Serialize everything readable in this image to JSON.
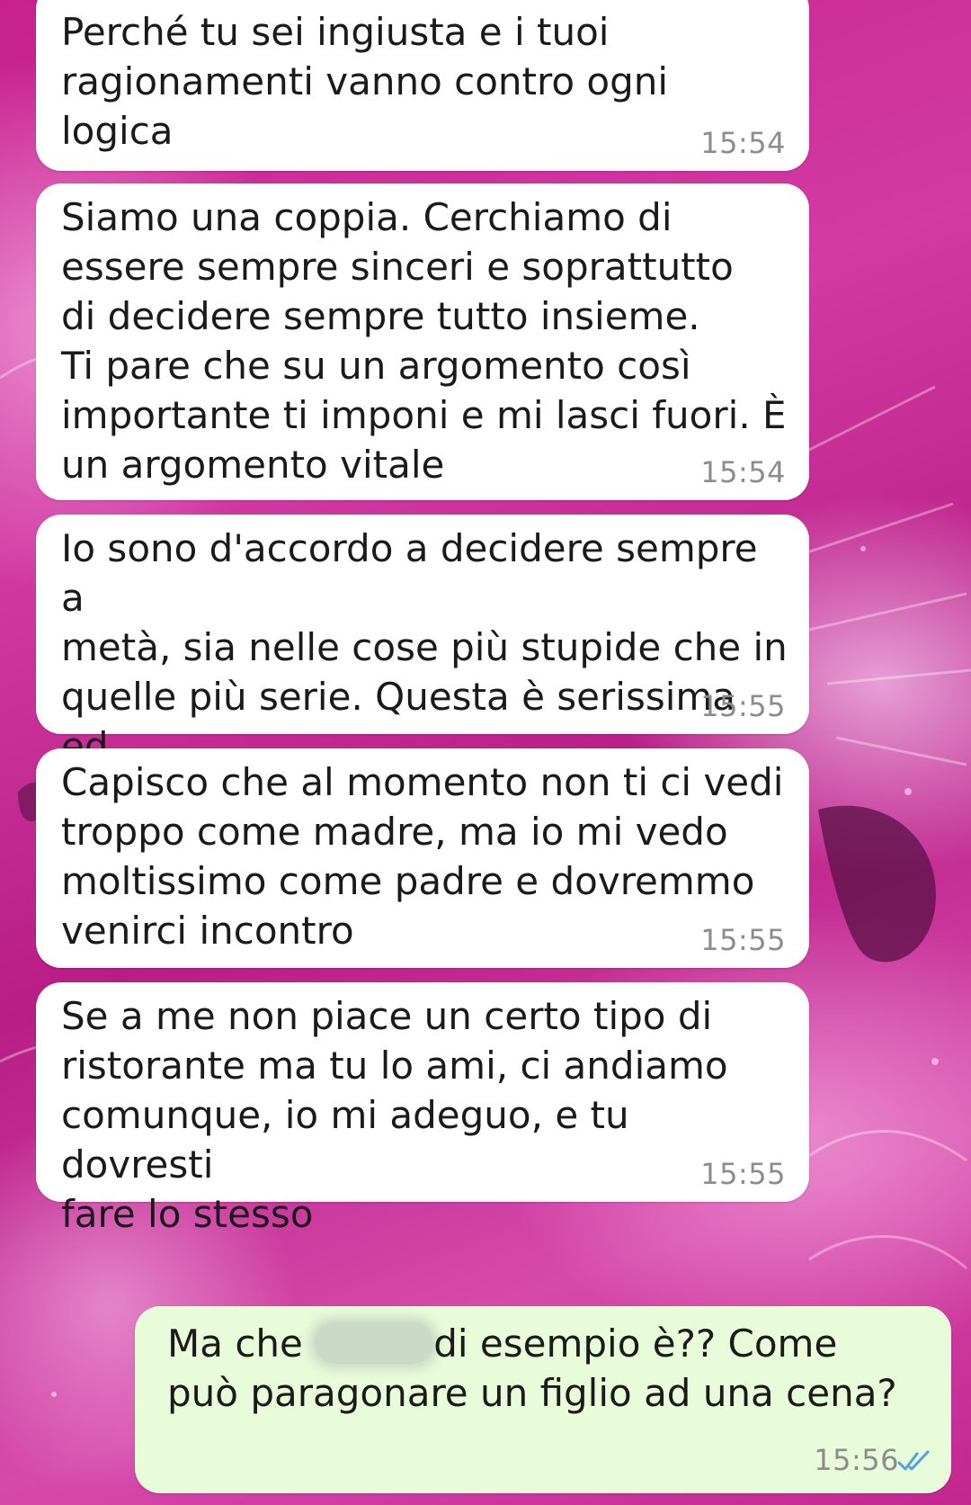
{
  "chat": {
    "messages": [
      {
        "direction": "incoming",
        "text": "Perché tu sei ingiusta e i tuoi\nragionamenti vanno contro ogni\nlogica",
        "time": "15:54"
      },
      {
        "direction": "incoming",
        "text": "Siamo una coppia. Cerchiamo di\nessere sempre sinceri e soprattutto\ndi decidere sempre tutto insieme.\nTi pare che su un argomento così\nimportante ti imponi e mi lasci fuori. È\nun argomento vitale",
        "time": "15:54"
      },
      {
        "direction": "incoming",
        "text": "Io sono d'accordo a decidere sempre a\nmetà, sia nelle cose più stupide che in\nquelle più serie. Questa è serissima ed\nè folle che sia tu a decidere",
        "time": "15:55"
      },
      {
        "direction": "incoming",
        "text": "Capisco che al momento non ti ci vedi\ntroppo come madre, ma io mi vedo\nmoltissimo come padre e dovremmo\nvenirci incontro",
        "time": "15:55"
      },
      {
        "direction": "incoming",
        "text": "Se a me non piace un certo tipo di\nristorante ma tu lo ami, ci andiamo\ncomunque, io mi adeguo, e tu dovresti\nfare lo stesso",
        "time": "15:55"
      },
      {
        "direction": "outgoing",
        "text_before_redaction": "Ma che ",
        "text_after_redaction": "di esempio è?? Come\npuò paragonare un figlio ad una cena?",
        "time": "15:56",
        "status_icon": "double-check-read-icon"
      }
    ]
  },
  "colors": {
    "incoming_bubble": "#ffffff",
    "outgoing_bubble": "#e9fcd9",
    "timestamp": "#8c8c8c",
    "read_ticks": "#4fa3e0",
    "wallpaper": "#c8208f"
  }
}
